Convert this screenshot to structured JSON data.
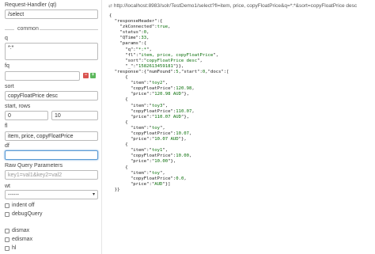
{
  "form": {
    "handler_label": "Request-Handler (qt)",
    "handler_value": "/select",
    "common_label": "common",
    "q_label": "q",
    "q_value": "*:*",
    "fq_label": "fq",
    "fq_value": "",
    "sort_label": "sort",
    "sort_value": "copyFloatPrice desc",
    "rows_label": "start, rows",
    "start_value": "0",
    "rows_value": "10",
    "fl_label": "fl",
    "fl_value": "item, price, copyFloatPrice",
    "df_label": "df",
    "df_value": "",
    "raw_label": "Raw Query Parameters",
    "raw_placeholder": "key1=val1&key2=val2",
    "wt_label": "wt",
    "wt_value": "------",
    "indent_label": "indent off",
    "debug_label": "debugQuery",
    "dismax_label": "dismax",
    "edismax_label": "edismax",
    "hl_label": "hl",
    "minus_symbol": "−",
    "plus_symbol": "+"
  },
  "colors": {
    "minus": "#d9534f",
    "plus": "#5cb85c",
    "focus": "#5b9bd5"
  },
  "url": "http://localhost:8983/solr/TestDemo1/select?fl=item, price, copyFloatPrice&q=*:*&sort=copyFloatPrice desc",
  "response": {
    "zkConnected": "true",
    "status": "0",
    "QTime": "33",
    "params": {
      "q": "*:*",
      "fl": "item, price, copyFloatPrice",
      "sort": "copyFloatPrice desc",
      "_": "1582613459181"
    },
    "numFound": "5",
    "start": "0",
    "docs": [
      {
        "item": "toy2",
        "copyFloatPrice": "120.98",
        "price": "120.98 AUD"
      },
      {
        "item": "toy3",
        "copyFloatPrice": "110.07",
        "price": "110.07 AUD"
      },
      {
        "item": "toy",
        "copyFloatPrice": "10.07",
        "price": "10.07 AUD"
      },
      {
        "item": "toy1",
        "copyFloatPrice": "10.00",
        "price": "10.00"
      },
      {
        "item": "toy",
        "copyFloatPrice": "0.0",
        "price": "AUD"
      }
    ]
  }
}
